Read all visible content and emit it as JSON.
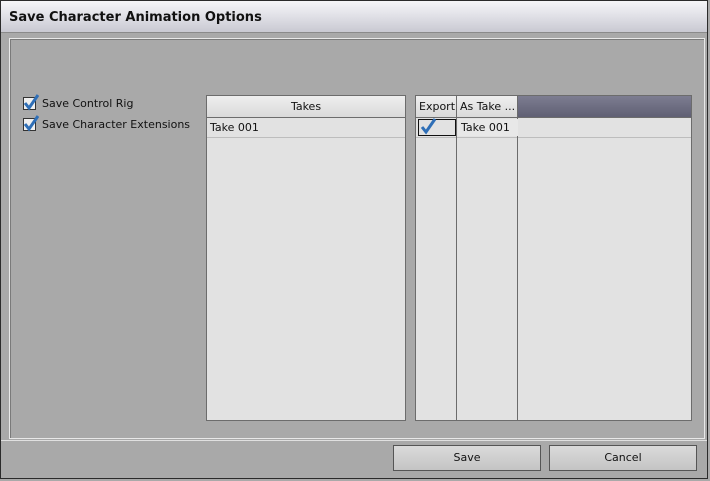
{
  "window": {
    "title": "Save Character Animation Options"
  },
  "options": [
    {
      "label": "Save Control Rig",
      "checked": true
    },
    {
      "label": "Save Character Extensions",
      "checked": true
    }
  ],
  "takes_list": {
    "header": "Takes",
    "items": [
      "Take 001"
    ]
  },
  "export_grid": {
    "columns": [
      "Export",
      "As Take ..."
    ],
    "rows": [
      {
        "export": true,
        "as_take": "Take 001"
      }
    ]
  },
  "buttons": {
    "save": "Save",
    "cancel": "Cancel"
  },
  "colors": {
    "check": "#2f6fb7",
    "background": "#a9a9a9",
    "header_accent": "#6a6a80"
  }
}
